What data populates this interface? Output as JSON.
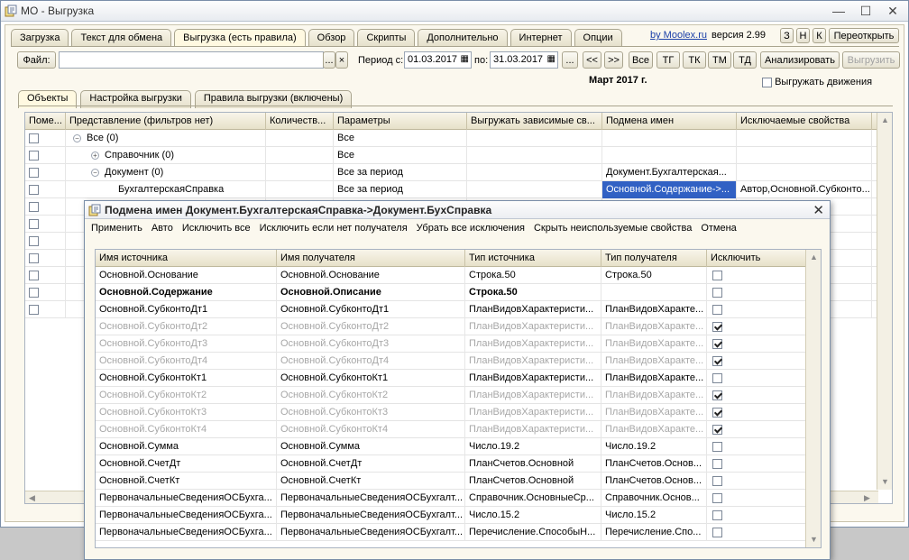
{
  "window": {
    "title": "МО - Выгрузка"
  },
  "top_tabs": [
    "Загрузка",
    "Текст для обмена",
    "Выгрузка (есть правила)",
    "Обзор",
    "Скрипты",
    "Дополнительно",
    "Интернет",
    "Опции"
  ],
  "top_tabs_active": 2,
  "link": "by Moolex.ru",
  "version": "версия 2.99",
  "small_buttons": [
    "З",
    "Н",
    "К"
  ],
  "reopen_button": "Переоткрыть",
  "file": {
    "label": "Файл:",
    "value": "",
    "browse": "...",
    "clear": "×"
  },
  "period": {
    "label_from": "Период с:",
    "from": "01.03.2017",
    "label_to": "по:",
    "to": "31.03.2017",
    "pick": "...",
    "prev": "<<",
    "next": ">>",
    "buttons": [
      "Все",
      "ТГ",
      "ТК",
      "ТМ",
      "ТД"
    ],
    "month": "Март 2017 г."
  },
  "analyze_button": "Анализировать",
  "export_button": "Выгрузить",
  "export_moves": {
    "label": "Выгружать движения",
    "checked": false
  },
  "inner_tabs": [
    "Объекты",
    "Настройка выгрузки",
    "Правила выгрузки (включены)"
  ],
  "objects": {
    "columns": [
      "Поме...",
      "Представление (фильтров нет)",
      "Количеств...",
      "Параметры",
      "Выгружать зависимые св...",
      "Подмена имен",
      "Исключаемые свойства"
    ],
    "rows": [
      {
        "level": 0,
        "toggle": "⊖",
        "name": "Все (0)",
        "count": "",
        "params": "Все",
        "dep": "",
        "subst": "",
        "excl": ""
      },
      {
        "level": 1,
        "toggle": "⊕",
        "name": "Справочник (0)",
        "count": "",
        "params": "Все",
        "dep": "",
        "subst": "",
        "excl": ""
      },
      {
        "level": 1,
        "toggle": "⊖",
        "name": "Документ (0)",
        "count": "",
        "params": "Все за период",
        "dep": "",
        "subst": "Документ.Бухгалтерская...",
        "excl": ""
      },
      {
        "level": 2,
        "toggle": "",
        "name": "БухгалтерскаяСправка",
        "count": "",
        "params": "Все за период",
        "dep": "",
        "subst": "Основной.Содержание->...",
        "excl": "Автор,Основной.Субконто..."
      }
    ],
    "empty_rows": 7
  },
  "dialog": {
    "title": "Подмена имен Документ.БухгалтерскаяСправка->Документ.БухСправка",
    "commands": [
      "Применить",
      "Авто",
      "Исключить все",
      "Исключить если нет получателя",
      "Убрать все исключения",
      "Скрыть неиспользуемые свойства",
      "Отмена"
    ],
    "columns": [
      "Имя источника",
      "Имя получателя",
      "Тип источника",
      "Тип получателя",
      "Исключить"
    ],
    "rows": [
      {
        "src": "Основной.Основание",
        "dst": "Основной.Основание",
        "stype": "Строка.50",
        "dtype": "Строка.50",
        "excl": false,
        "style": ""
      },
      {
        "src": "Основной.Содержание",
        "dst": "Основной.Описание",
        "stype": "Строка.50",
        "dtype": "",
        "excl": false,
        "style": "bold"
      },
      {
        "src": "Основной.СубконтоДт1",
        "dst": "Основной.СубконтоДт1",
        "stype": "ПланВидовХарактеристи...",
        "dtype": "ПланВидовХаракте...",
        "excl": false,
        "style": ""
      },
      {
        "src": "Основной.СубконтоДт2",
        "dst": "Основной.СубконтоДт2",
        "stype": "ПланВидовХарактеристи...",
        "dtype": "ПланВидовХаракте...",
        "excl": true,
        "style": "dim"
      },
      {
        "src": "Основной.СубконтоДт3",
        "dst": "Основной.СубконтоДт3",
        "stype": "ПланВидовХарактеристи...",
        "dtype": "ПланВидовХаракте...",
        "excl": true,
        "style": "dim"
      },
      {
        "src": "Основной.СубконтоДт4",
        "dst": "Основной.СубконтоДт4",
        "stype": "ПланВидовХарактеристи...",
        "dtype": "ПланВидовХаракте...",
        "excl": true,
        "style": "dim"
      },
      {
        "src": "Основной.СубконтоКт1",
        "dst": "Основной.СубконтоКт1",
        "stype": "ПланВидовХарактеристи...",
        "dtype": "ПланВидовХаракте...",
        "excl": false,
        "style": ""
      },
      {
        "src": "Основной.СубконтоКт2",
        "dst": "Основной.СубконтоКт2",
        "stype": "ПланВидовХарактеристи...",
        "dtype": "ПланВидовХаракте...",
        "excl": true,
        "style": "dim"
      },
      {
        "src": "Основной.СубконтоКт3",
        "dst": "Основной.СубконтоКт3",
        "stype": "ПланВидовХарактеристи...",
        "dtype": "ПланВидовХаракте...",
        "excl": true,
        "style": "dim"
      },
      {
        "src": "Основной.СубконтоКт4",
        "dst": "Основной.СубконтоКт4",
        "stype": "ПланВидовХарактеристи...",
        "dtype": "ПланВидовХаракте...",
        "excl": true,
        "style": "dim"
      },
      {
        "src": "Основной.Сумма",
        "dst": "Основной.Сумма",
        "stype": "Число.19.2",
        "dtype": "Число.19.2",
        "excl": false,
        "style": ""
      },
      {
        "src": "Основной.СчетДт",
        "dst": "Основной.СчетДт",
        "stype": "ПланСчетов.Основной",
        "dtype": "ПланСчетов.Основ...",
        "excl": false,
        "style": ""
      },
      {
        "src": "Основной.СчетКт",
        "dst": "Основной.СчетКт",
        "stype": "ПланСчетов.Основной",
        "dtype": "ПланСчетов.Основ...",
        "excl": false,
        "style": ""
      },
      {
        "src": "ПервоначальныеСведенияОСБухга...",
        "dst": "ПервоначальныеСведенияОСБухгалт...",
        "stype": "Справочник.ОсновныеСр...",
        "dtype": "Справочник.Основ...",
        "excl": false,
        "style": ""
      },
      {
        "src": "ПервоначальныеСведенияОСБухга...",
        "dst": "ПервоначальныеСведенияОСБухгалт...",
        "stype": "Число.15.2",
        "dtype": "Число.15.2",
        "excl": false,
        "style": ""
      },
      {
        "src": "ПервоначальныеСведенияОСБухга...",
        "dst": "ПервоначальныеСведенияОСБухгалт...",
        "stype": "Перечисление.СпособыН...",
        "dtype": "Перечисление.Спо...",
        "excl": false,
        "style": ""
      }
    ]
  }
}
